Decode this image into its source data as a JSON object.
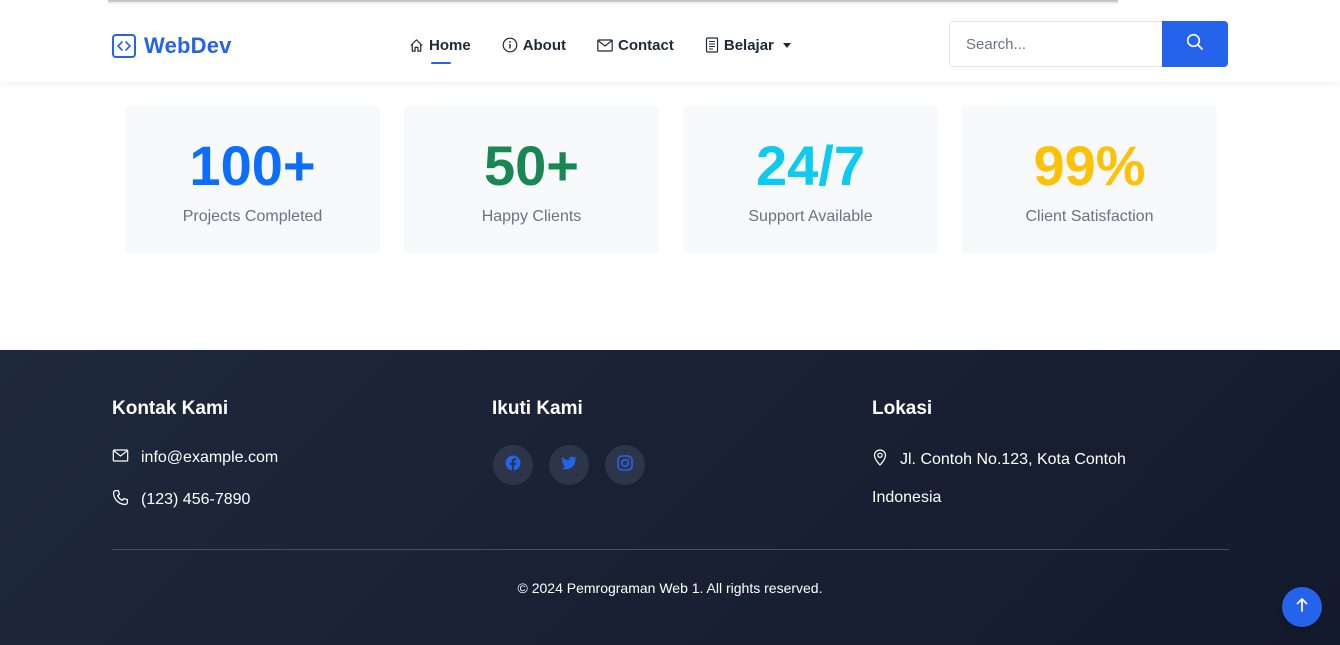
{
  "brand": {
    "name": "WebDev",
    "icon": "code-icon"
  },
  "nav": {
    "home": "Home",
    "about": "About",
    "contact": "Contact",
    "belajar": "Belajar"
  },
  "search": {
    "placeholder": "Search...",
    "icon": "search-icon"
  },
  "stats": [
    {
      "value": "100+",
      "label": "Projects Completed",
      "color": "#0d6efd"
    },
    {
      "value": "50+",
      "label": "Happy Clients",
      "color": "#198754"
    },
    {
      "value": "24/7",
      "label": "Support Available",
      "color": "#0dcaf0"
    },
    {
      "value": "99%",
      "label": "Client Satisfaction",
      "color": "#ffc107"
    }
  ],
  "footer": {
    "contact_title": "Kontak Kami",
    "email": "info@example.com",
    "phone": "(123) 456-7890",
    "social_title": "Ikuti Kami",
    "social": [
      "facebook-icon",
      "twitter-icon",
      "instagram-icon"
    ],
    "location_title": "Lokasi",
    "address_line1": "Jl. Contoh No.123, Kota Contoh",
    "address_line2": "Indonesia",
    "copyright": "© 2024 Pemrograman Web 1. All rights reserved."
  },
  "colors": {
    "accent": "#2563eb",
    "footer_bg": "#1e293b"
  }
}
